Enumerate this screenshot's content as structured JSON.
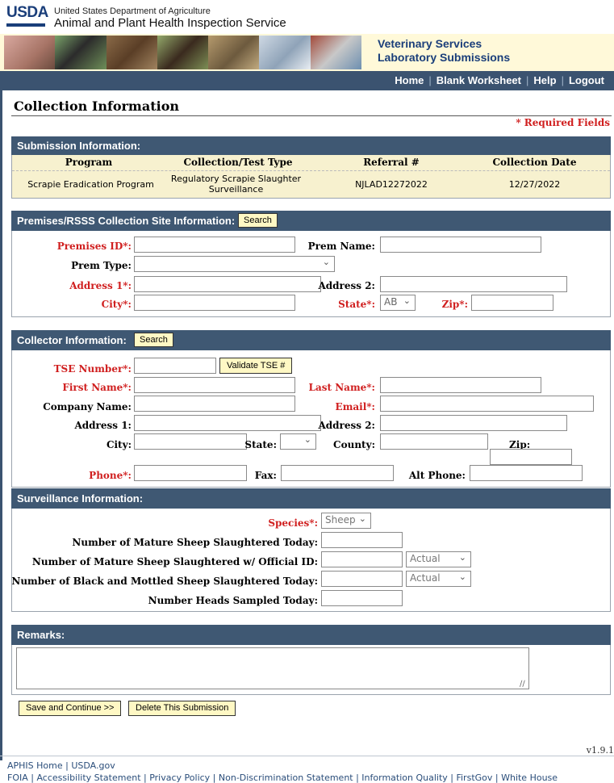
{
  "header": {
    "logo_text": "USDA",
    "department": "United States Department of Agriculture",
    "agency": "Animal and Plant Health Inspection Service",
    "service_line1": "Veterinary Services",
    "service_line2": "Laboratory Submissions"
  },
  "nav": {
    "home": "Home",
    "blank_worksheet": "Blank Worksheet",
    "help": "Help",
    "logout": "Logout",
    "separator": "|"
  },
  "page": {
    "title": "Collection Information",
    "required_note": "* Required Fields"
  },
  "submission": {
    "heading": "Submission Information:",
    "columns": [
      "Program",
      "Collection/Test Type",
      "Referral #",
      "Collection Date"
    ],
    "row": {
      "program": "Scrapie Eradication Program",
      "test_type_line1": "Regulatory Scrapie Slaughter",
      "test_type_line2": "Surveillance",
      "referral": "NJLAD12272022",
      "date": "12/27/2022"
    }
  },
  "premises": {
    "heading": "Premises/RSSS Collection Site Information:",
    "search_button": "Search",
    "labels": {
      "premises_id": "Premises ID*:",
      "prem_name": "Prem Name:",
      "prem_type": "Prem Type:",
      "address1": "Address 1*:",
      "address2": "Address 2:",
      "city": "City*:",
      "state": "State*:",
      "zip": "Zip*:"
    },
    "state_value": "AB"
  },
  "collector": {
    "heading": "Collector Information:",
    "search_button": "Search",
    "validate_button": "Validate TSE #",
    "labels": {
      "tse_number": "TSE Number*:",
      "first_name": "First Name*:",
      "last_name": "Last Name*:",
      "company_name": "Company Name:",
      "email": "Email*:",
      "address1": "Address 1:",
      "address2": "Address 2:",
      "city": "City:",
      "state": "State:",
      "county": "County:",
      "zip": "Zip:",
      "phone": "Phone*:",
      "fax": "Fax:",
      "alt_phone": "Alt Phone:"
    }
  },
  "surveillance": {
    "heading": "Surveillance Information:",
    "labels": {
      "species": "Species*:",
      "mature_slaughtered": "Number of Mature Sheep Slaughtered Today:",
      "mature_official_id": "Number of Mature Sheep Slaughtered w/ Official ID:",
      "black_mottled": "Number of Black and Mottled Sheep Slaughtered Today:",
      "heads_sampled": "Number Heads Sampled Today:"
    },
    "species_value": "Sheep",
    "actual_option": "Actual"
  },
  "remarks": {
    "heading": "Remarks:"
  },
  "buttons": {
    "save_continue": "Save and Continue >>",
    "delete_submission": "Delete This Submission"
  },
  "footer": {
    "version": "v1.9.1",
    "line1": "APHIS Home | USDA.gov",
    "line2": "FOIA | Accessibility Statement | Privacy Policy | Non-Discrimination Statement | Information Quality | FirstGov | White House"
  },
  "colors": {
    "nav_bar": "#3b5370",
    "section_header": "#3f5873",
    "required_red": "#d01f1f",
    "button_yellow": "#fff8c4",
    "table_row": "#f7f1cf"
  }
}
